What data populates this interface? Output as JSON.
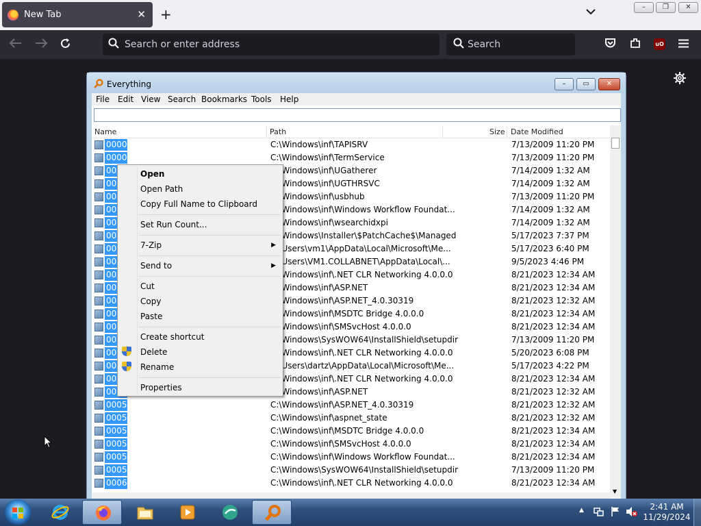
{
  "browser": {
    "tab_title": "New Tab",
    "tab_close_icon": "✕",
    "new_tab_label": "+",
    "list_tabs_icon": "⌄",
    "url_placeholder": "Search or enter address",
    "search_placeholder": "Search",
    "window_buttons": [
      "–",
      "❐",
      "✕"
    ]
  },
  "everything": {
    "title": "Everything",
    "menu": [
      "File",
      "Edit",
      "View",
      "Search",
      "Bookmarks",
      "Tools",
      "Help"
    ],
    "search_value": "",
    "columns": [
      "Name",
      "Path",
      "Size",
      "Date Modified"
    ],
    "rows": [
      {
        "name": "0000",
        "path": "C:\\Windows\\inf\\TAPISRV",
        "date": "7/13/2009 11:20 PM"
      },
      {
        "name": "0000",
        "path": "C:\\Windows\\inf\\TermService",
        "date": "7/13/2009 11:20 PM"
      },
      {
        "name": "0000",
        "path": "C:\\Windows\\inf\\UGatherer",
        "date": "7/14/2009 1:32 AM"
      },
      {
        "name": "0000",
        "path": "C:\\Windows\\inf\\UGTHRSVC",
        "date": "7/14/2009 1:32 AM"
      },
      {
        "name": "0000",
        "path": "C:\\Windows\\inf\\usbhub",
        "date": "7/13/2009 11:20 PM"
      },
      {
        "name": "0000",
        "path": "C:\\Windows\\inf\\Windows Workflow Foundat...",
        "date": "7/14/2009 1:32 AM"
      },
      {
        "name": "0000",
        "path": "C:\\Windows\\inf\\wsearchidxpi",
        "date": "7/14/2009 1:32 AM"
      },
      {
        "name": "0000",
        "path": "C:\\Windows\\Installer\\$PatchCache$\\Managed",
        "date": "5/17/2023 7:37 PM"
      },
      {
        "name": "0000",
        "path": "C:\\Users\\vm1\\AppData\\Local\\Microsoft\\Me...",
        "date": "5/17/2023 6:40 PM"
      },
      {
        "name": "0000",
        "path": "C:\\Users\\VM1.COLLABNET\\AppData\\Local\\...",
        "date": "9/5/2023 4:46 PM"
      },
      {
        "name": "0000",
        "path": "C:\\Windows\\inf\\.NET CLR Networking 4.0.0.0",
        "date": "8/21/2023 12:34 AM"
      },
      {
        "name": "0000",
        "path": "C:\\Windows\\inf\\ASP.NET",
        "date": "8/21/2023 12:34 AM"
      },
      {
        "name": "0000",
        "path": "C:\\Windows\\inf\\ASP.NET_4.0.30319",
        "date": "8/21/2023 12:32 AM"
      },
      {
        "name": "0000",
        "path": "C:\\Windows\\inf\\MSDTC Bridge 4.0.0.0",
        "date": "8/21/2023 12:34 AM"
      },
      {
        "name": "0000",
        "path": "C:\\Windows\\inf\\SMSvcHost 4.0.0.0",
        "date": "8/21/2023 12:34 AM"
      },
      {
        "name": "0000",
        "path": "C:\\Windows\\SysWOW64\\InstallShield\\setupdir",
        "date": "7/13/2009 11:20 PM"
      },
      {
        "name": "0000",
        "path": "C:\\Windows\\inf\\.NET CLR Networking 4.0.0.0",
        "date": "5/20/2023 6:08 PM"
      },
      {
        "name": "0000",
        "path": "C:\\Users\\dartz\\AppData\\Local\\Microsoft\\Me...",
        "date": "5/17/2023 4:22 PM"
      },
      {
        "name": "0000",
        "path": "C:\\Windows\\inf\\.NET CLR Networking 4.0.0.0",
        "date": "8/21/2023 12:34 AM"
      },
      {
        "name": "0000",
        "path": "C:\\Windows\\inf\\ASP.NET",
        "date": "8/21/2023 12:32 AM"
      },
      {
        "name": "0005",
        "path": "C:\\Windows\\inf\\ASP.NET_4.0.30319",
        "date": "8/21/2023 12:32 AM"
      },
      {
        "name": "0005",
        "path": "C:\\Windows\\inf\\aspnet_state",
        "date": "8/21/2023 12:32 AM"
      },
      {
        "name": "0005",
        "path": "C:\\Windows\\inf\\MSDTC Bridge 4.0.0.0",
        "date": "8/21/2023 12:34 AM"
      },
      {
        "name": "0005",
        "path": "C:\\Windows\\inf\\SMSvcHost 4.0.0.0",
        "date": "8/21/2023 12:34 AM"
      },
      {
        "name": "0005",
        "path": "C:\\Windows\\inf\\Windows Workflow Foundat...",
        "date": "8/21/2023 12:34 AM"
      },
      {
        "name": "0005",
        "path": "C:\\Windows\\SysWOW64\\InstallShield\\setupdir",
        "date": "7/13/2009 11:20 PM"
      },
      {
        "name": "0006",
        "path": "C:\\Windows\\inf\\.NET CLR Networking 4.0.0.0",
        "date": "8/21/2023 12:34 AM"
      }
    ]
  },
  "context_menu": {
    "open": "Open",
    "open_path": "Open Path",
    "copy_full_name": "Copy Full Name to Clipboard",
    "set_run_count": "Set Run Count...",
    "zip": "7-Zip",
    "send_to": "Send to",
    "cut": "Cut",
    "copy": "Copy",
    "paste": "Paste",
    "create_shortcut": "Create shortcut",
    "delete": "Delete",
    "rename": "Rename",
    "properties": "Properties"
  },
  "taskbar": {
    "time": "2:41 AM",
    "date": "11/29/2024"
  },
  "colors": {
    "selection": "#3399ff",
    "firefox_toolbar": "#2b2a33",
    "taskbar": "#2f4f7a"
  }
}
